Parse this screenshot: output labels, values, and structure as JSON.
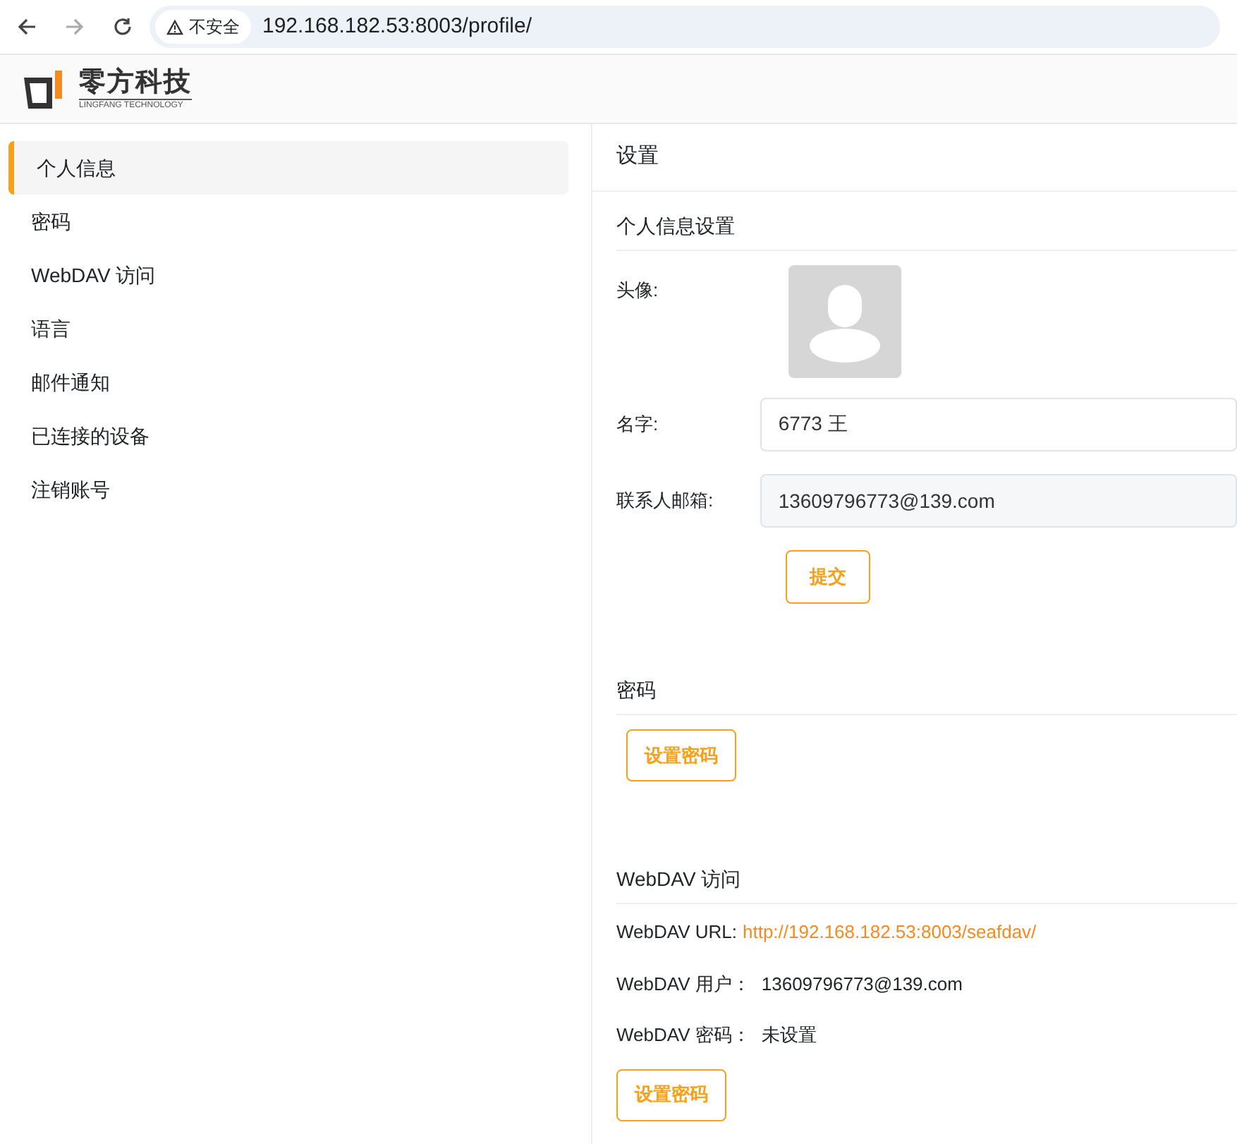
{
  "browser": {
    "security": "不安全",
    "url": "192.168.182.53:8003/profile/"
  },
  "logo": {
    "name": "零方科技",
    "subtitle": "LINGFANG TECHNOLOGY"
  },
  "sidebar": {
    "items": [
      {
        "label": "个人信息",
        "selected": true
      },
      {
        "label": "密码",
        "selected": false
      },
      {
        "label": "WebDAV 访问",
        "selected": false
      },
      {
        "label": "语言",
        "selected": false
      },
      {
        "label": "邮件通知",
        "selected": false
      },
      {
        "label": "已连接的设备",
        "selected": false
      },
      {
        "label": "注销账号",
        "selected": false
      }
    ]
  },
  "content": {
    "title": "设置",
    "profile": {
      "heading": "个人信息设置",
      "avatar_label": "头像:",
      "name_label": "名字:",
      "name_value": "6773 王",
      "email_label": "联系人邮箱:",
      "email_value": "13609796773@139.com",
      "submit": "提交"
    },
    "password": {
      "heading": "密码",
      "button": "设置密码"
    },
    "webdav": {
      "heading": "WebDAV 访问",
      "url_label": "WebDAV URL:",
      "url": "http://192.168.182.53:8003/seafdav/",
      "user_label": "WebDAV 用户：",
      "user": "13609796773@139.com",
      "password_label": "WebDAV 密码：",
      "password": "未设置",
      "button": "设置密码"
    }
  }
}
